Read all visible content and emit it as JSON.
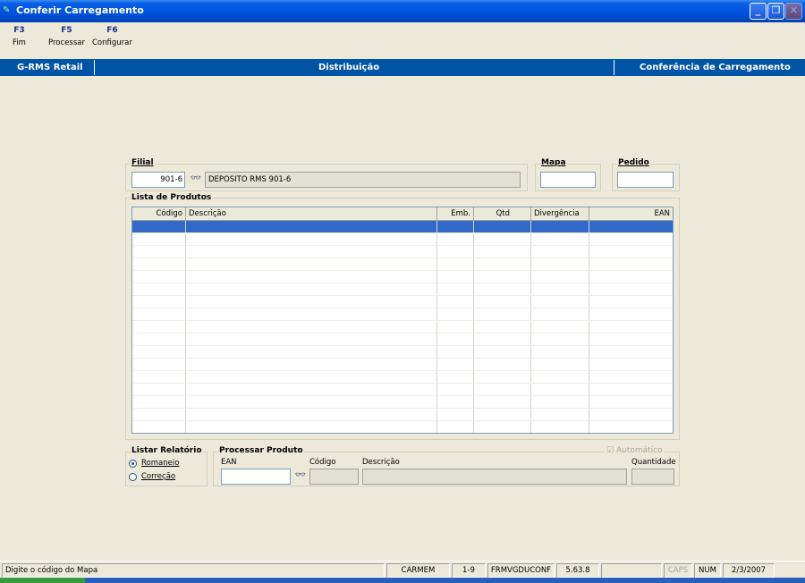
{
  "window": {
    "title": "Conferir Carregamento"
  },
  "toolbar": [
    {
      "key": "F3",
      "label": "Fim"
    },
    {
      "key": "F5",
      "label": "Processar"
    },
    {
      "key": "F6",
      "label": "Configurar"
    }
  ],
  "header": {
    "left": "G-RMS Retail",
    "center": "Distribuição",
    "right": "Conferência de Carregamento"
  },
  "filial": {
    "label": "Filial",
    "code": "901-6",
    "description": "DEPOSITO RMS 901-6"
  },
  "mapa": {
    "label": "Mapa",
    "value": ""
  },
  "pedido": {
    "label": "Pedido",
    "value": ""
  },
  "produtos": {
    "label": "Lista de Produtos",
    "columns": [
      "Código",
      "Descrição",
      "Emb.",
      "Qtd",
      "Divergência",
      "EAN"
    ]
  },
  "relatorio": {
    "label": "Listar Relatório",
    "options": [
      {
        "label": "Romaneio",
        "selected": true
      },
      {
        "label": "Correção",
        "selected": false
      }
    ]
  },
  "processar": {
    "label": "Processar Produto",
    "automatico": "Automático",
    "ean_label": "EAN",
    "codigo_label": "Código",
    "descricao_label": "Descrição",
    "quantidade_label": "Quantidade"
  },
  "status": {
    "message": "Digite o código do Mapa",
    "user": "CARMEM",
    "filial": "1-9",
    "form": "FRMVGDUCONF",
    "version": "5.63.8",
    "empty": "",
    "caps": "CAPS",
    "num": "NUM",
    "date": "2/3/2007"
  }
}
